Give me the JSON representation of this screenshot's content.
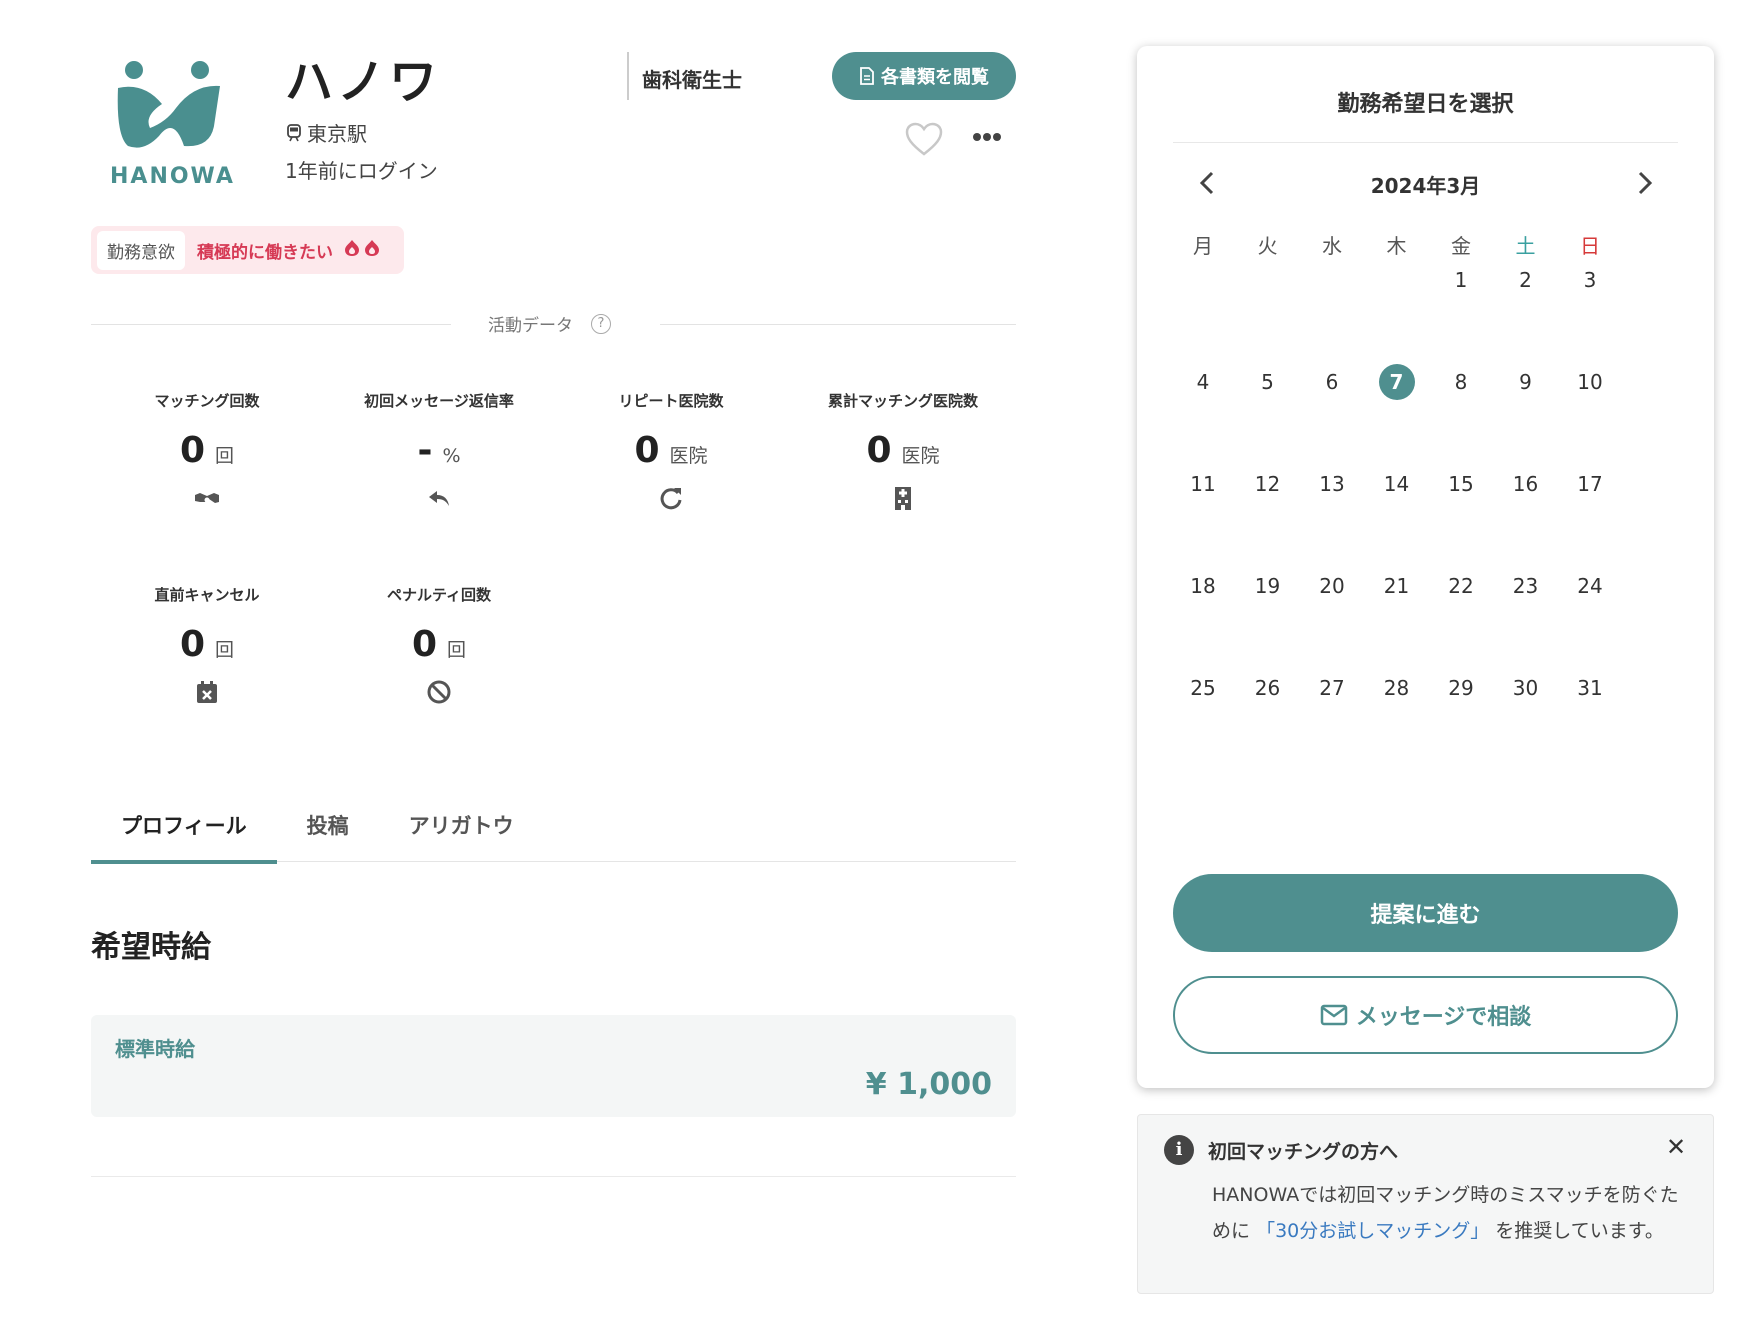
{
  "profile": {
    "logo_text": "HANOWA",
    "name": "ハノワ",
    "station": "東京駅",
    "last_login": "1年前にログイン",
    "occupation": "歯科衛生士",
    "docs_button": "各書類を閲覧",
    "motivation_label": "勤務意欲",
    "motivation_value": "積極的に働きたい",
    "motivation_flames": "🔥🔥"
  },
  "activity": {
    "title": "活動データ",
    "help": "?",
    "stats": [
      {
        "label": "マッチング回数",
        "value": "0",
        "unit": "回",
        "icon": "handshake-icon"
      },
      {
        "label": "初回メッセージ返信率",
        "value": "-",
        "unit": "%",
        "icon": "reply-icon"
      },
      {
        "label": "リピート医院数",
        "value": "0",
        "unit": "医院",
        "icon": "repeat-icon"
      },
      {
        "label": "累計マッチング医院数",
        "value": "0",
        "unit": "医院",
        "icon": "hospital-icon"
      },
      {
        "label": "直前キャンセル",
        "value": "0",
        "unit": "回",
        "icon": "calendar-x-icon"
      },
      {
        "label": "ペナルティ回数",
        "value": "0",
        "unit": "回",
        "icon": "ban-icon"
      }
    ]
  },
  "tabs": [
    {
      "label": "プロフィール",
      "active": true
    },
    {
      "label": "投稿",
      "active": false
    },
    {
      "label": "アリガトウ",
      "active": false
    }
  ],
  "wage": {
    "heading": "希望時給",
    "label": "標準時給",
    "value": "¥ 1,000"
  },
  "calendar": {
    "title": "勤務希望日を選択",
    "month": "2024年3月",
    "weekdays": [
      "月",
      "火",
      "水",
      "木",
      "金",
      "土",
      "日"
    ],
    "first_weekday_index": 4,
    "days_in_month": 31,
    "selected_day": 7,
    "propose_button": "提案に進む",
    "message_button": "メッセージで相談"
  },
  "notice": {
    "title": "初回マッチングの方へ",
    "close": "✕",
    "body_before": "HANOWAでは初回マッチング時のミスマッチを防ぐために",
    "body_link": "「30分お試しマッチング」",
    "body_after": "を推奨しています。"
  },
  "colors": {
    "accent": "#4f8f8f",
    "motivation": "#d63a55",
    "saturday": "#3aa0a0",
    "sunday": "#d63a3a",
    "link": "#3a7ac0"
  }
}
